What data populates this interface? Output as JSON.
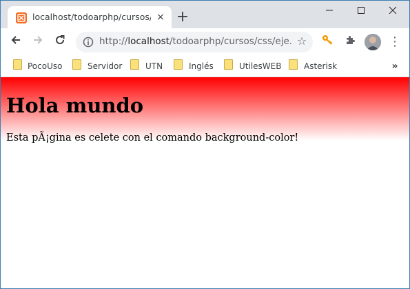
{
  "browser": {
    "tab": {
      "title": "localhost/todoarphp/cursos/css/ejer",
      "close_glyph": "×"
    },
    "new_tab_glyph": "+",
    "window_controls": {
      "minimize": "—",
      "maximize": "☐",
      "close": "✕"
    },
    "toolbar": {
      "back_glyph": "←",
      "forward_glyph": "→",
      "reload_glyph": "↻",
      "url_prefix": "http://",
      "url_host": "localhost",
      "url_path": "/todoarphp/cursos/css/eje...",
      "star_glyph": "☆",
      "menu_glyph": "⋮"
    },
    "bookmarks": [
      {
        "label": "PocoUso"
      },
      {
        "label": "Servidor"
      },
      {
        "label": "UTN"
      },
      {
        "label": "Inglés"
      },
      {
        "label": "UtilesWEB"
      },
      {
        "label": "Asterisk"
      }
    ],
    "bookmarks_more": "»"
  },
  "page": {
    "heading": "Hola mundo",
    "paragraph": "Esta pÃ¡gina es celete con el comando background-color!",
    "gradient_colors": [
      "#ff0000",
      "#ffffff"
    ]
  }
}
